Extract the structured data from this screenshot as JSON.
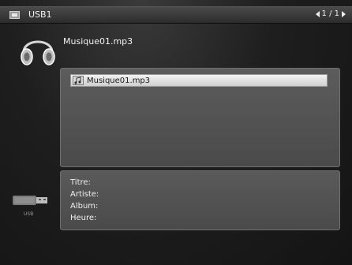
{
  "topbar": {
    "icon": "usb-drive-icon",
    "device": "USB1",
    "pager": "1 / 1"
  },
  "header": {
    "icon": "headphones-icon",
    "now_playing": "Musique01.mp3"
  },
  "file_list": {
    "items": [
      {
        "icon": "music-note-icon",
        "label": "Musique01.mp3",
        "selected": true
      }
    ]
  },
  "info": {
    "title_label": "Titre:",
    "artist_label": "Artiste:",
    "album_label": "Album:",
    "time_label": "Heure:"
  },
  "source": {
    "icon": "usb-stick-icon",
    "label": "USB"
  },
  "colors": {
    "highlight": "#e6e6e6",
    "panel": "#555555"
  }
}
